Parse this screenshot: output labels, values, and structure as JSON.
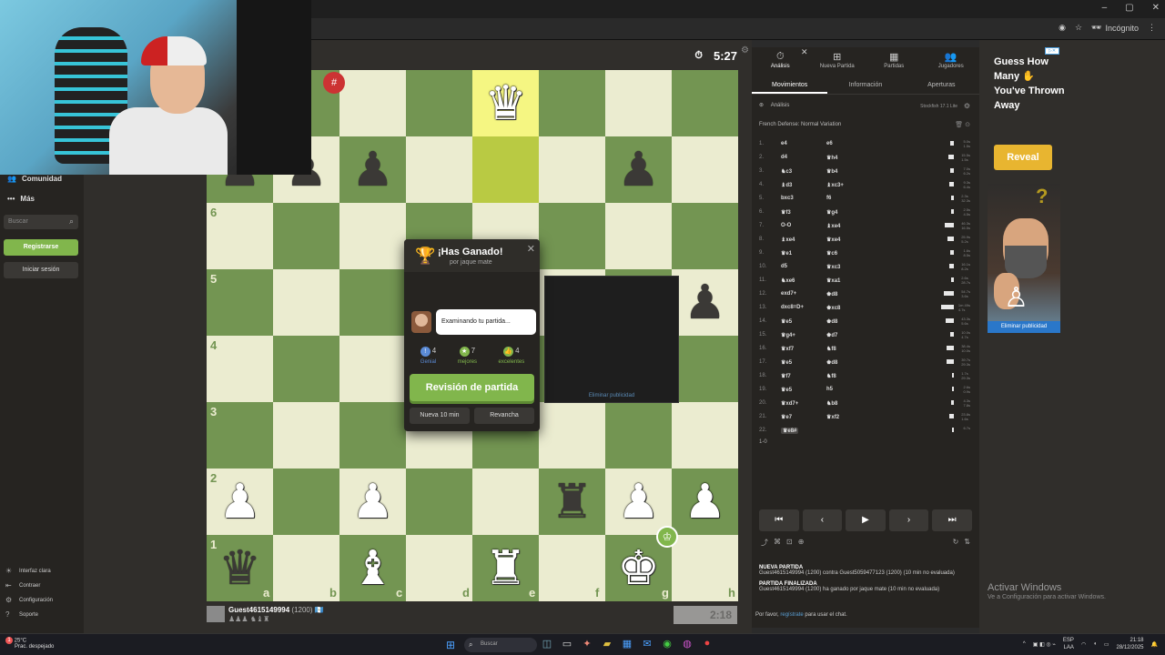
{
  "browser": {
    "window_controls": [
      "–",
      "▢",
      "✕"
    ],
    "incognito_label": "Incógnito"
  },
  "sidebar": {
    "items_top": [
      {
        "label": "Comunidad",
        "icon": "users-icon"
      },
      {
        "label": "Más",
        "icon": "more-icon"
      }
    ],
    "search_placeholder": "Buscar",
    "register_label": "Registrarse",
    "login_label": "Iniciar sesión",
    "items_bottom": [
      {
        "label": "Interfaz clara",
        "icon": "sun-icon"
      },
      {
        "label": "Contraer",
        "icon": "collapse-icon"
      },
      {
        "label": "Configuración",
        "icon": "gear-icon"
      },
      {
        "label": "Soporte",
        "icon": "help-icon"
      }
    ]
  },
  "game": {
    "top_clock": "5:27",
    "bottom_clock": "2:18",
    "bottom_player": {
      "name": "Guest4615149994",
      "rating": "(1200)",
      "captured": "♟♟♟ ♞♝♜"
    },
    "ranks": [
      "6",
      "5",
      "4",
      "3",
      "2",
      "1"
    ],
    "files": [
      "a",
      "b",
      "c",
      "d",
      "e",
      "f",
      "g",
      "h"
    ]
  },
  "modal": {
    "title": "¡Has Ganado!",
    "subtitle": "por jaque mate",
    "coach_message": "Examinando tu partida...",
    "stats": [
      {
        "icon": "!",
        "count": "4",
        "label": "Genial",
        "color": "#5b8bd6"
      },
      {
        "icon": "★",
        "count": "7",
        "label": "mejores",
        "color": "#81b64c"
      },
      {
        "icon": "👍",
        "count": "4",
        "label": "excelentes",
        "color": "#81b64c"
      }
    ],
    "review_label": "Revisión de partida",
    "new_game_label": "Nueva 10 min",
    "rematch_label": "Revancha",
    "ad_remove_label": "Eliminar publicidad"
  },
  "panel": {
    "top_tabs": [
      {
        "label": "Análisis",
        "icon": "⏱",
        "active": true
      },
      {
        "label": "Nueva Partida",
        "icon": "⊞",
        "active": false
      },
      {
        "label": "Partidas",
        "icon": "▦",
        "active": false
      },
      {
        "label": "Jugadores",
        "icon": "👥",
        "active": false
      }
    ],
    "sub_tabs": [
      {
        "label": "Movimientos",
        "active": true
      },
      {
        "label": "Información",
        "active": false
      },
      {
        "label": "Aperturas",
        "active": false
      }
    ],
    "analysis_label": "Análisis",
    "engine_label": "Stockfish 17.1 Lite",
    "opening_name": "French Defense: Normal Variation",
    "moves": [
      {
        "n": "1.",
        "w": "e4",
        "b": "e6",
        "bar": 4,
        "t1": "5.0s",
        "t2": "1.5s"
      },
      {
        "n": "2.",
        "w": "d4",
        "b": "♛h4",
        "bar": 6,
        "t1": "15.5s",
        "t2": "1.5s"
      },
      {
        "n": "3.",
        "w": "♞c3",
        "b": "♛b4",
        "bar": 4,
        "t1": "7.0s",
        "t2": "6.2s"
      },
      {
        "n": "4.",
        "w": "♝d3",
        "b": "♝xc3+",
        "bar": 5,
        "t1": "9.3s",
        "t2": "6.4s"
      },
      {
        "n": "5.",
        "w": "bxc3",
        "b": "f6",
        "bar": 3,
        "t1": "2.3s",
        "t2": "32.3s"
      },
      {
        "n": "6.",
        "w": "♛f3",
        "b": "♛g4",
        "bar": 3,
        "t1": "2.5s",
        "t2": "4.5s"
      },
      {
        "n": "7.",
        "w": "O-O",
        "b": "♝xe4",
        "bar": 10,
        "t1": "46.3s",
        "t2": "16.5s"
      },
      {
        "n": "8.",
        "w": "♝xe4",
        "b": "♛xe4",
        "bar": 7,
        "t1": "25.9s",
        "t2": "5.2s"
      },
      {
        "n": "9.",
        "w": "♛e1",
        "b": "♛c6",
        "bar": 4,
        "t1": "1.6s",
        "t2": "8.5s"
      },
      {
        "n": "10.",
        "w": "d5",
        "b": "♛xc3",
        "bar": 5,
        "t1": "16.1s",
        "t2": "8.2s"
      },
      {
        "n": "11.",
        "w": "♞xe6",
        "b": "♛xa1",
        "bar": 3,
        "t1": "2.6s",
        "t2": "28.7s"
      },
      {
        "n": "12.",
        "w": "exd7+",
        "b": "♚d8",
        "bar": 11,
        "t1": "54.7s",
        "t2": "3.6s"
      },
      {
        "n": "13.",
        "w": "dxc8=D+",
        "b": "♚xc8",
        "bar": 14,
        "t1": "1m 49s",
        "t2": "4.7s"
      },
      {
        "n": "14.",
        "w": "♛e5",
        "b": "♚d8",
        "bar": 9,
        "t1": "43.3s",
        "t2": "5.6s"
      },
      {
        "n": "15.",
        "w": "♛g4+",
        "b": "♚d7",
        "bar": 4,
        "t1": "10.0s",
        "t2": "4.7s"
      },
      {
        "n": "16.",
        "w": "♛xf7",
        "b": "♞f8",
        "bar": 8,
        "t1": "38.4s",
        "t2": "10.0s"
      },
      {
        "n": "17.",
        "w": "♛e5",
        "b": "♚d8",
        "bar": 8,
        "t1": "39.7s",
        "t2": "29.3s"
      },
      {
        "n": "18.",
        "w": "♛f7",
        "b": "♞f8",
        "bar": 2,
        "t1": "1.7s",
        "t2": "29.3s"
      },
      {
        "n": "19.",
        "w": "♛e5",
        "b": "h5",
        "bar": 2,
        "t1": "2.6s",
        "t2": "0.9s"
      },
      {
        "n": "20.",
        "w": "♛xd7+",
        "b": "♞b8",
        "bar": 3,
        "t1": "4.3s",
        "t2": "7.8s"
      },
      {
        "n": "21.",
        "w": "♛e7",
        "b": "♛xf2",
        "bar": 5,
        "t1": "23.8s",
        "t2": "1.6s"
      },
      {
        "n": "22.",
        "w": "♛e8#",
        "b": "",
        "bar": 2,
        "t1": "6.7s",
        "t2": ""
      }
    ],
    "result": "1-0",
    "events": [
      {
        "head": "NUEVA PARTIDA",
        "text": "Guest4615149994 (1200) contra Guest5059477123 (1200) (10 min no evaluada)"
      },
      {
        "head": "PARTIDA FINALIZADA",
        "text": "Guest4615149994 (1200) ha ganado por jaque mate (10 min no evaluada)"
      }
    ],
    "chat_prefix": "Por favor,",
    "chat_link": "regístrate",
    "chat_suffix": "para usar el chat."
  },
  "ad": {
    "headline": "Guess How Many ✋ You've Thrown Away",
    "reveal_label": "Reveal",
    "remove_label": "Eliminar publicidad",
    "qmark": "?"
  },
  "windows": {
    "activate_title": "Activar Windows",
    "activate_sub": "Ve a Configuración para activar Windows.",
    "weather_temp": "25°C",
    "weather_desc": "Prac. despejado",
    "search_label": "Buscar",
    "lang": "ESP",
    "lang_sub": "LAA",
    "time": "21:18",
    "date": "28/12/2025"
  }
}
